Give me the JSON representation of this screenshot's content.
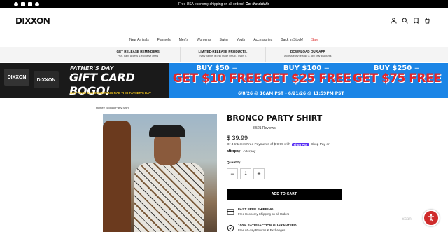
{
  "announcement": {
    "text": "Free USA economy shipping on all orders!",
    "link": "Get the details"
  },
  "social_icons": [
    "facebook-icon",
    "youtube-icon",
    "instagram-icon",
    "tiktok-icon"
  ],
  "brand": {
    "logo": "DIXXON"
  },
  "header_icons": [
    "account-icon",
    "search-icon",
    "wishlist-icon",
    "cart-icon"
  ],
  "nav": {
    "items": [
      "New Arrivals",
      "Flannels",
      "Men's",
      "Women's",
      "Swim",
      "Youth",
      "Accessories",
      "Back in Stock!",
      "Sale"
    ]
  },
  "perks": [
    {
      "title": "GET RELEASE REMINDERS",
      "sub": "Plus, early access & exclusive offers"
    },
    {
      "title": "LIMITED-RELEASE PRODUCTS.",
      "sub": "Every flannel is only made ONCE. That's it."
    },
    {
      "title": "DOWNLOAD OUR APP",
      "sub": "Access early release & app only discounts"
    }
  ],
  "banner": {
    "promo_title": "FATHER'S DAY",
    "promo_headline": "GIFT CARD BOGO!",
    "promo_sub": "GET YOUR DAD SOMETHING RAD THIS FATHER'S DAY",
    "offers": [
      {
        "buy": "BUY $50 =",
        "get": "GET $10 FREE"
      },
      {
        "buy": "BUY $100 =",
        "get": "GET $25 FREE"
      },
      {
        "buy": "BUY $250 =",
        "get": "GET $75 FREE"
      }
    ],
    "dates": "6/8/26 @ 10AM PST - 6/21/26 @ 11:59PM PST",
    "card_logo": "DIXXON"
  },
  "breadcrumb": {
    "home": "Home",
    "separator": "›",
    "current": "Bronco Party Shirt"
  },
  "product": {
    "title": "BRONCO PARTY SHIRT",
    "reviews": "8,521 Reviews",
    "price": "$ 39.99",
    "installments_prefix": "Or 4 Interest-Free Payments of $ 9.99 with",
    "shop_pay_logo": "shop Pay",
    "installments_suffix": "Shop Pay or",
    "afterpay_logo": "afterpay",
    "afterpay_label": "Afterpay",
    "quantity_label": "Quantity",
    "quantity_value": "1",
    "add_to_cart": "ADD TO CART"
  },
  "features": [
    {
      "title": "FAST FREE SHIPPING",
      "sub": "Free Economy Shipping on all Orders"
    },
    {
      "title": "100% SATISFACTION GUARANTEED",
      "sub": "Free 60-day Returns & Exchanges"
    }
  ],
  "colors": {
    "accent": "#000000",
    "sale": "#dd3333",
    "banner_blue": "#1b85e6",
    "offer_red": "#e3262a",
    "shoppay": "#5a31f4",
    "accessibility": "#cf2b2b"
  },
  "watermark": "Scan"
}
